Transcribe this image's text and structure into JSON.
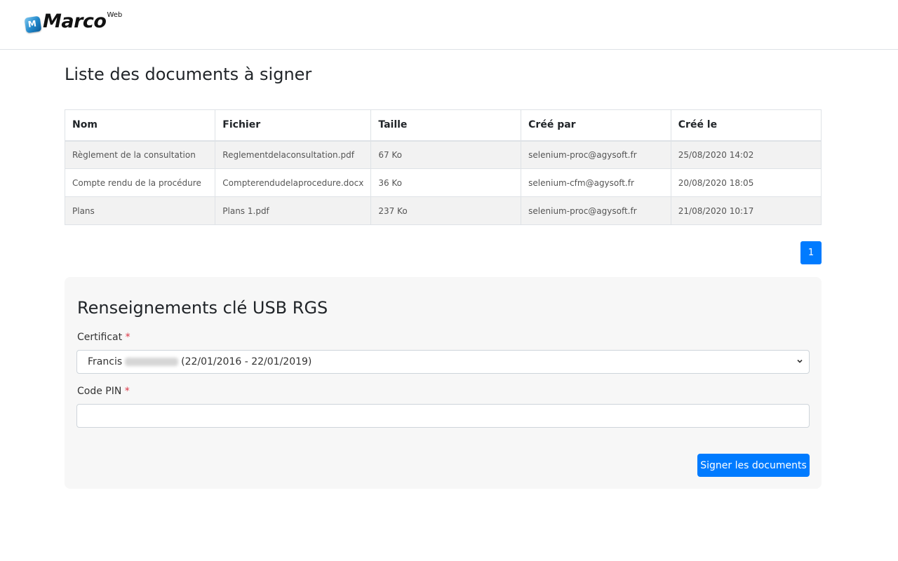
{
  "header": {
    "logo_text": "Marco",
    "logo_sup": "Web"
  },
  "page_title": "Liste des documents à signer",
  "table": {
    "columns": [
      "Nom",
      "Fichier",
      "Taille",
      "Créé par",
      "Créé le"
    ],
    "rows": [
      [
        "Règlement de la consultation",
        "Reglementdelaconsultation.pdf",
        "67 Ko",
        "selenium-proc@agysoft.fr",
        "25/08/2020 14:02"
      ],
      [
        "Compte rendu de la procédure",
        "Compterendudelaprocedure.docx",
        "36 Ko",
        "selenium-cfm@agysoft.fr",
        "20/08/2020 18:05"
      ],
      [
        "Plans",
        "Plans 1.pdf",
        "237 Ko",
        "selenium-proc@agysoft.fr",
        "21/08/2020 10:17"
      ]
    ]
  },
  "pagination": {
    "current": "1"
  },
  "form": {
    "title": "Renseignements clé USB RGS",
    "certificat_label": "Certificat",
    "required_mark": "*",
    "certificat_first_name": "Francis",
    "certificat_dates": "(22/01/2016 - 22/01/2019)",
    "pin_label": "Code PIN",
    "pin_value": "",
    "submit_label": "Signer les documents"
  },
  "colors": {
    "accent": "#007bff",
    "required": "#dc3545",
    "panel_bg": "#f7f7f7",
    "row_stripe": "#f2f2f2"
  }
}
